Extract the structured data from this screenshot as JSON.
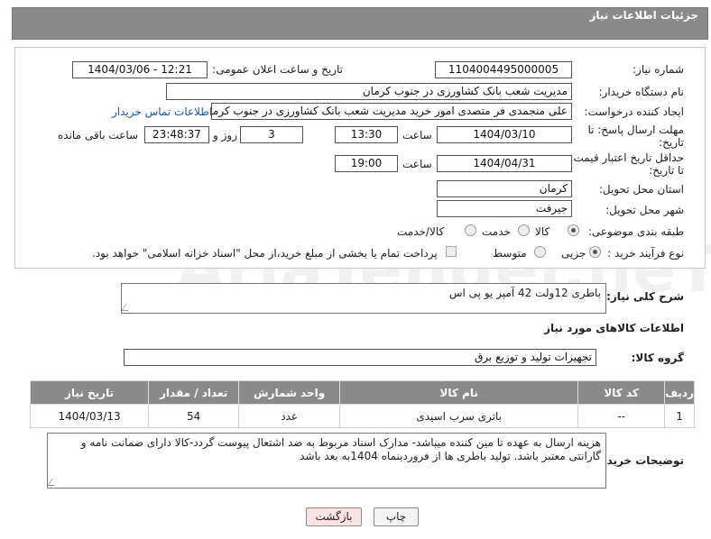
{
  "header": {
    "title": "جزئیات اطلاعات نیاز"
  },
  "watermark": "AriaTender.neT",
  "form": {
    "need_number_label": "شماره نیاز:",
    "need_number": "1104004495000005",
    "announce_label": "تاریخ و ساعت اعلان عمومی:",
    "announce_value": "1404/03/06 - 12:21",
    "buyer_org_label": "نام دستگاه خریدار:",
    "buyer_org": "مدیریت شعب بانک کشاورزی در جنوب کرمان",
    "creator_label": "ایجاد کننده درخواست:",
    "creator": "علی منجمدی فر  متصدی امور خرید  مدیریت شعب بانک کشاورزی در جنوب کرمان",
    "contact_link": "اطلاعات تماس خریدار",
    "deadline_label": "مهلت ارسال پاسخ: تا تاریخ:",
    "deadline_date": "1404/03/10",
    "time_label": "ساعت",
    "deadline_time": "13:30",
    "days_value": "3",
    "days_label": "روز و",
    "remaining_value": "23:48:37",
    "remaining_label": "ساعت باقی مانده",
    "validity_label": "حداقل تاریخ اعتبار قیمت: تا تاریخ:",
    "validity_date": "1404/04/31",
    "validity_time": "19:00",
    "province_label": "استان محل تحویل:",
    "province": "کرمان",
    "city_label": "شهر محل تحویل:",
    "city": "جیرفت",
    "category_label": "طبقه بندی موضوعی:",
    "category_options": [
      "کالا",
      "خدمت",
      "کالا/خدمت"
    ],
    "process_label": "نوع فرآیند خرید :",
    "process_options": [
      "جزیی",
      "متوسط"
    ],
    "payment_note": "پرداخت تمام یا بخشی از مبلغ خرید،از محل \"اسناد خزانه اسلامی\" خواهد بود."
  },
  "description": {
    "label": "شرح کلی نیاز:",
    "text": "باطری 12ولت 42 آمپر یو پی اس"
  },
  "goods_info": {
    "title": "اطلاعات کالاهای مورد نیاز",
    "group_label": "گروه کالا:",
    "group_value": "تجهیزات تولید و توزیع برق"
  },
  "table": {
    "headers": [
      "ردیف",
      "کد کالا",
      "نام کالا",
      "واحد شمارش",
      "تعداد / مقدار",
      "تاریخ نیاز"
    ],
    "rows": [
      [
        "1",
        "--",
        "باتری سرب اسیدی",
        "عدد",
        "54",
        "1404/03/13"
      ]
    ]
  },
  "buyer_notes": {
    "label": "توضیحات خریدار:",
    "text": "هزینه ارسال به عهده تا مین کننده میباشد- مدارک اسناد مربوط به ضد اشتعال پیوست گردد-کالا دارای ضمانت نامه و گارانتی معتبر باشد. تولید باطری ها از فروردینماه 1404به بعد باشد"
  },
  "buttons": {
    "print": "چاپ",
    "back": "بازگشت"
  }
}
